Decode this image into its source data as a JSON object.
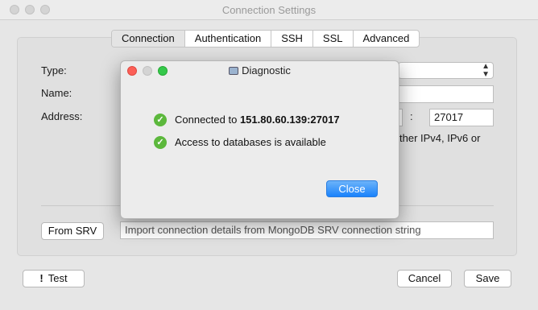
{
  "window": {
    "title": "Connection Settings"
  },
  "tabs": [
    {
      "label": "Connection",
      "active": true
    },
    {
      "label": "Authentication"
    },
    {
      "label": "SSH"
    },
    {
      "label": "SSL"
    },
    {
      "label": "Advanced"
    }
  ],
  "form": {
    "type_label": "Type:",
    "name_label": "Name:",
    "address_label": "Address:",
    "port_separator": ":",
    "port_value": "27017",
    "address_hint_fragment": "ther IPv4, IPv6 or"
  },
  "srv": {
    "button_label": "From SRV",
    "placeholder": "Import connection details from MongoDB SRV connection string"
  },
  "footer": {
    "test_label": "Test",
    "test_icon_glyph": "!",
    "cancel_label": "Cancel",
    "save_label": "Save"
  },
  "diagnostic": {
    "title": "Diagnostic",
    "connected_prefix": "Connected to ",
    "connected_host": "151.80.60.139:27017",
    "access_message": "Access to databases is available",
    "check_glyph": "✓",
    "close_label": "Close"
  },
  "colors": {
    "accent_blue": "#1a82fb",
    "success_green": "#5cb83c",
    "traffic_red": "#fc5f57",
    "traffic_yellow": "#fdbc2e",
    "traffic_green": "#34c84a"
  }
}
